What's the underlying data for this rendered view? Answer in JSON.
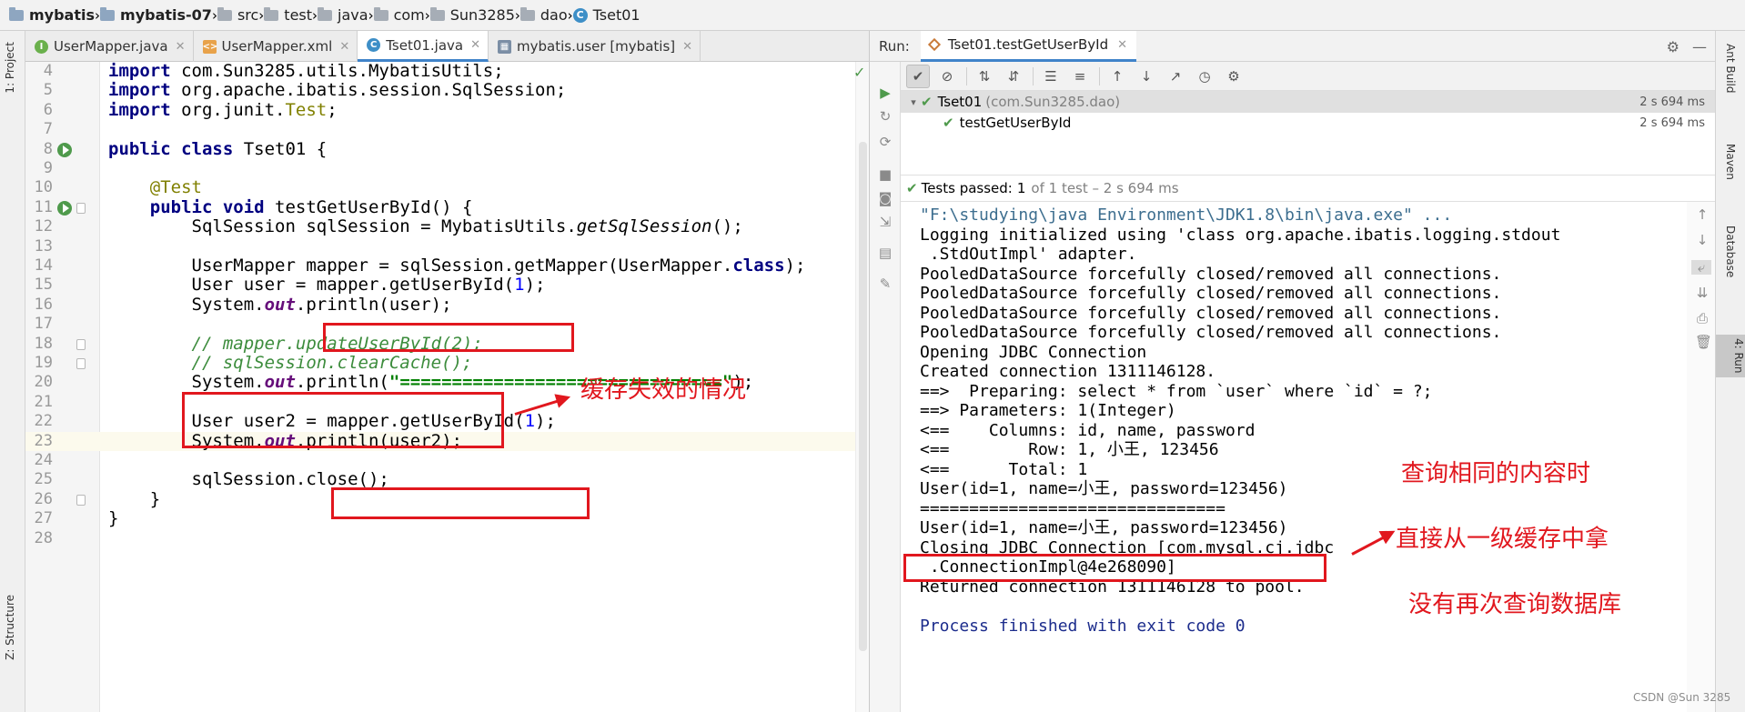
{
  "breadcrumb": [
    {
      "label": "mybatis",
      "kind": "project",
      "bold": true
    },
    {
      "label": "mybatis-07",
      "kind": "module",
      "bold": true
    },
    {
      "label": "src",
      "kind": "folder"
    },
    {
      "label": "test",
      "kind": "folder"
    },
    {
      "label": "java",
      "kind": "folder"
    },
    {
      "label": "com",
      "kind": "folder"
    },
    {
      "label": "Sun3285",
      "kind": "folder"
    },
    {
      "label": "dao",
      "kind": "folder"
    },
    {
      "label": "Tset01",
      "kind": "class"
    }
  ],
  "left_strip": {
    "project": "1: Project",
    "structure": "Z: Structure"
  },
  "editor_tabs": [
    {
      "label": "UserMapper.java",
      "icon": "interface-icon",
      "icon_char": "I",
      "active": false
    },
    {
      "label": "UserMapper.xml",
      "icon": "xml-icon",
      "icon_char": "<>",
      "active": false
    },
    {
      "label": "Tset01.java",
      "icon": "class-icon",
      "icon_char": "C",
      "active": true
    },
    {
      "label": "mybatis.user [mybatis]",
      "icon": "table-icon",
      "icon_char": "▦",
      "active": false
    }
  ],
  "code_lines": [
    {
      "n": "4",
      "html": "<span class=\"kw\">import</span> com.Sun3285.utils.MybatisUtils;"
    },
    {
      "n": "5",
      "html": "<span class=\"kw\">import</span> org.apache.ibatis.session.SqlSession;"
    },
    {
      "n": "6",
      "html": "<span class=\"kw\">import</span> org.junit.<span class=\"test-name\">Test</span>;"
    },
    {
      "n": "7",
      "html": ""
    },
    {
      "n": "8",
      "html": "<span class=\"kw\">public class</span> Tset01 {",
      "run": true
    },
    {
      "n": "9",
      "html": ""
    },
    {
      "n": "10",
      "html": "    <span class=\"ann\">@Test</span>"
    },
    {
      "n": "11",
      "html": "    <span class=\"kw\">public void</span> testGetUserById() {",
      "run": true,
      "fold": true
    },
    {
      "n": "12",
      "html": "        SqlSession sqlSession = MybatisUtils.<span class=\"method-i\">getSqlSession</span>();"
    },
    {
      "n": "13",
      "html": ""
    },
    {
      "n": "14",
      "html": "        UserMapper mapper = sqlSession.getMapper(UserMapper.<span class=\"kw\">class</span>);"
    },
    {
      "n": "15",
      "html": "        User user = mapper.getUserById(<span class=\"num\">1</span>);"
    },
    {
      "n": "16",
      "html": "        System.<span class=\"static\">out</span>.println(user);"
    },
    {
      "n": "17",
      "html": ""
    },
    {
      "n": "18",
      "html": "        <span class=\"cmt\">// mapper.updateUserById(2);</span>",
      "fold": true
    },
    {
      "n": "19",
      "html": "        <span class=\"cmt\">// sqlSession.clearCache();</span>",
      "fold": true
    },
    {
      "n": "20",
      "html": "        System.<span class=\"static\">out</span>.println(<span class=\"str\">\"===============================\"</span>);"
    },
    {
      "n": "21",
      "html": ""
    },
    {
      "n": "22",
      "html": "        User user2 = mapper.getUserById(<span class=\"num\">1</span>);"
    },
    {
      "n": "23",
      "html": "        System.<span class=\"static\">out</span>.println(user2);",
      "current": true
    },
    {
      "n": "24",
      "html": ""
    },
    {
      "n": "25",
      "html": "        sqlSession.close();"
    },
    {
      "n": "26",
      "html": "    }",
      "fold": true
    },
    {
      "n": "27",
      "html": "}"
    },
    {
      "n": "28",
      "html": ""
    }
  ],
  "annotations": {
    "cache_invalid": "缓存失效的情况",
    "same_query": "查询相同的内容时",
    "from_cache": "直接从一级缓存中拿",
    "no_db": "没有再次查询数据库"
  },
  "run": {
    "label": "Run:",
    "tab": "Tset01.testGetUserById",
    "tree": [
      {
        "name": "Tset01",
        "pkg": "(com.Sun3285.dao)",
        "duration": "2 s 694 ms"
      },
      {
        "name": "testGetUserById",
        "duration": "2 s 694 ms"
      }
    ],
    "status": {
      "passed": "Tests passed:",
      "count": "1",
      "rest": "of 1 test – 2 s 694 ms"
    },
    "console": [
      {
        "text": "\"F:\\studying\\java Environment\\JDK1.8\\bin\\java.exe\" ...",
        "kind": "cmd"
      },
      {
        "text": "Logging initialized using 'class org.apache.ibatis.logging.stdout",
        "kind": "out"
      },
      {
        "text": " .StdOutImpl' adapter.",
        "kind": "out"
      },
      {
        "text": "PooledDataSource forcefully closed/removed all connections.",
        "kind": "out"
      },
      {
        "text": "PooledDataSource forcefully closed/removed all connections.",
        "kind": "out"
      },
      {
        "text": "PooledDataSource forcefully closed/removed all connections.",
        "kind": "out"
      },
      {
        "text": "PooledDataSource forcefully closed/removed all connections.",
        "kind": "out"
      },
      {
        "text": "Opening JDBC Connection",
        "kind": "out"
      },
      {
        "text": "Created connection 1311146128.",
        "kind": "out"
      },
      {
        "text": "==>  Preparing: select * from `user` where `id` = ?;",
        "kind": "out"
      },
      {
        "text": "==> Parameters: 1(Integer)",
        "kind": "out"
      },
      {
        "text": "<==    Columns: id, name, password",
        "kind": "out"
      },
      {
        "text": "<==        Row: 1, 小王, 123456",
        "kind": "out"
      },
      {
        "text": "<==      Total: 1",
        "kind": "out"
      },
      {
        "text": "User(id=1, name=小王, password=123456)",
        "kind": "out"
      },
      {
        "text": "===============================",
        "kind": "out"
      },
      {
        "text": "User(id=1, name=小王, password=123456)",
        "kind": "out"
      },
      {
        "text": "Closing JDBC Connection [com.mysql.cj.jdbc",
        "kind": "out"
      },
      {
        "text": " .ConnectionImpl@4e268090]",
        "kind": "out"
      },
      {
        "text": "Returned connection 1311146128 to pool.",
        "kind": "out"
      },
      {
        "text": "",
        "kind": "out"
      },
      {
        "text": "Process finished with exit code 0",
        "kind": "exit"
      }
    ]
  },
  "right_strip": {
    "ant": "Ant Build",
    "maven": "Maven",
    "database": "Database",
    "run": "4: Run"
  },
  "watermark": "CSDN @Sun 3285",
  "colors": {
    "accent": "#4083c9",
    "annotation_red": "#e1171e",
    "pass_green": "#4f9a4c"
  }
}
